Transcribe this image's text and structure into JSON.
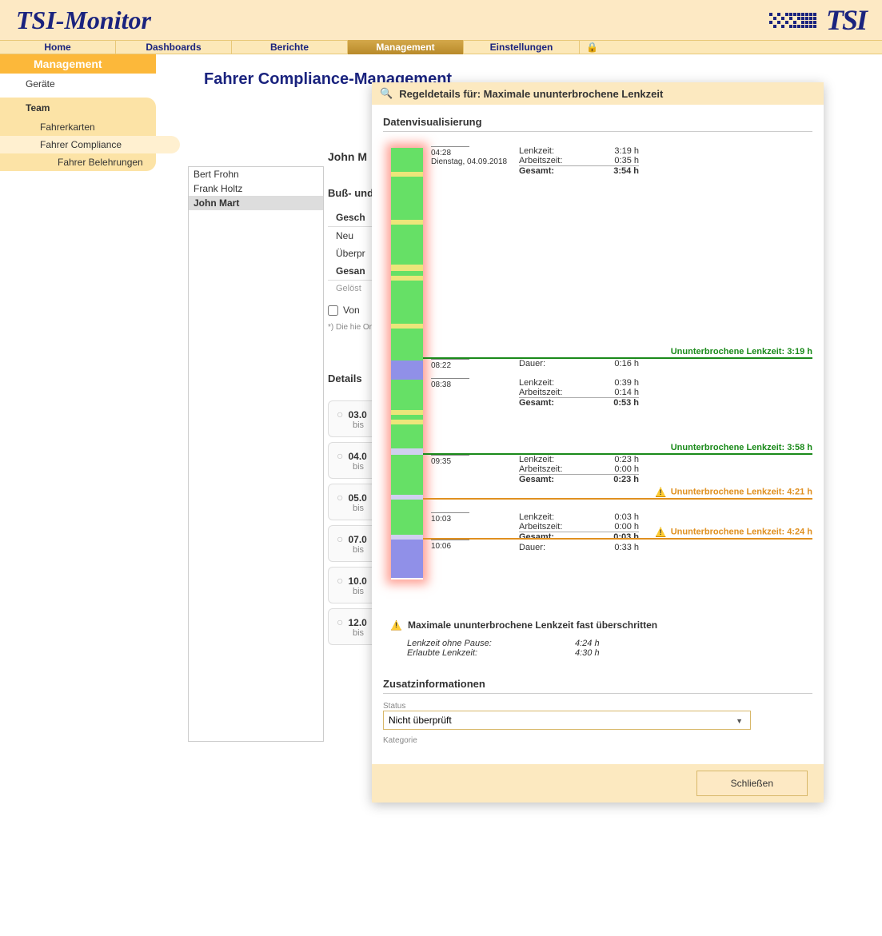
{
  "app_title": "TSI-Monitor",
  "main_nav": [
    "Home",
    "Dashboards",
    "Berichte",
    "Management",
    "Einstellungen"
  ],
  "main_nav_active": 3,
  "sidebar": {
    "title": "Management",
    "item_devices": "Geräte",
    "group_team": "Team",
    "sub_cards": "Fahrerkarten",
    "sub_compliance": "Fahrer Compliance",
    "sub_training": "Fahrer Belehrungen"
  },
  "page_heading": "Fahrer Compliance-Management",
  "drivers": [
    "Bert Frohn",
    "Frank Holtz",
    "John Mart"
  ],
  "driver_selected": 2,
  "back": {
    "name": "John M",
    "section1": "Buß- und",
    "h1": "Gesch",
    "r1": "Neu",
    "r2": "Überpr",
    "h2": "Gesan",
    "r3": "Gelöst",
    "check": "Von",
    "foot": "*) Die hie Ordnung: Geldbuße wenden S",
    "details_title": "Details",
    "cards": [
      {
        "d": "03.0",
        "b": "bis"
      },
      {
        "d": "04.0",
        "b": "bis"
      },
      {
        "d": "05.0",
        "b": "bis"
      },
      {
        "d": "07.0",
        "b": "bis"
      },
      {
        "d": "10.0",
        "b": "bis"
      },
      {
        "d": "12.0",
        "b": "bis"
      }
    ]
  },
  "modal": {
    "title": "Regeldetails für: Maximale ununterbrochene Lenkzeit",
    "viz_title": "Datenvisualisierung",
    "ticks": {
      "t1": "04:28",
      "date": "Dienstag, 04.09.2018",
      "t2": "08:22",
      "t3": "08:38",
      "t4": "09:35",
      "t5": "10:03",
      "t6": "10:06"
    },
    "block1": {
      "l1": "Lenkzeit:",
      "v1": "3:19 h",
      "l2": "Arbeitszeit:",
      "v2": "0:35 h",
      "lg": "Gesamt:",
      "vg": "3:54 h"
    },
    "block2": {
      "l1": "Dauer:",
      "v1": "0:16 h"
    },
    "block3": {
      "l1": "Lenkzeit:",
      "v1": "0:39 h",
      "l2": "Arbeitszeit:",
      "v2": "0:14 h",
      "lg": "Gesamt:",
      "vg": "0:53 h"
    },
    "block4": {
      "l1": "Lenkzeit:",
      "v1": "0:23 h",
      "l2": "Arbeitszeit:",
      "v2": "0:00 h",
      "lg": "Gesamt:",
      "vg": "0:23 h"
    },
    "block5": {
      "l1": "Lenkzeit:",
      "v1": "0:03 h",
      "l2": "Arbeitszeit:",
      "v2": "0:00 h",
      "lg": "Gesamt:",
      "vg": "0:03 h"
    },
    "block6": {
      "l1": "Dauer:",
      "v1": "0:33 h"
    },
    "markers": {
      "m1": "Ununterbrochene Lenkzeit:   3:19 h",
      "m2": "Ununterbrochene Lenkzeit:   3:58 h",
      "m3": "Ununterbrochene Lenkzeit:   4:21 h",
      "m4": "Ununterbrochene Lenkzeit:   4:24 h"
    },
    "warn_summary": "Maximale ununterbrochene Lenkzeit fast überschritten",
    "stats": {
      "l1": "Lenkzeit ohne Pause:",
      "v1": "4:24 h",
      "l2": "Erlaubte Lenkzeit:",
      "v2": "4:30 h"
    },
    "extra_title": "Zusatzinformationen",
    "status_label": "Status",
    "status_value": "Nicht überprüft",
    "cat_label": "Kategorie",
    "close_btn": "Schließen"
  }
}
